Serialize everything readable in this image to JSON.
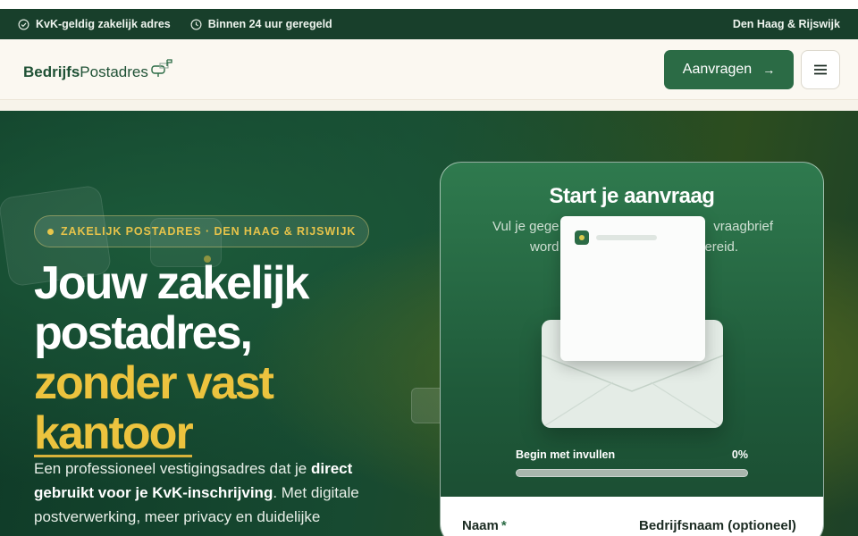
{
  "topbar": {
    "item1": "KvK-geldig zakelijk adres",
    "item2": "Binnen 24 uur geregeld",
    "location": "Den Haag & Rijswijk"
  },
  "header": {
    "logo_bold": "Bedrijfs",
    "logo_light": "Postadres",
    "cta_label": "Aanvragen",
    "cta_arrow": "→"
  },
  "hero": {
    "badge": "ZAKELIJK POSTADRES · DEN HAAG & RIJSWIJK",
    "headline_line1": "Jouw zakelijk",
    "headline_line2": "postadres,",
    "headline_line3": "zonder vast",
    "headline_line4": "kantoor",
    "sub_part1": "Een professioneel vestigingsadres dat je ",
    "sub_bold": "direct gebruikt voor je KvK-inschrijving",
    "sub_part2": ". Met digitale postverwerking, meer privacy en duidelijke"
  },
  "card": {
    "title": "Start je aanvraag",
    "subtitle_left1": "Vul je gege",
    "subtitle_right1": "vraagbrief",
    "subtitle_left2": "word",
    "subtitle_right2": "ereid.",
    "progress_label": "Begin met invullen",
    "progress_pct": "0%",
    "progress_value": 0,
    "field_name": "Naam",
    "required_mark": "*",
    "field_company": "Bedrijfsnaam (optioneel)"
  },
  "colors": {
    "brand_green": "#2b6b45",
    "gold": "#ecc33e",
    "topbar": "#183f2b"
  }
}
